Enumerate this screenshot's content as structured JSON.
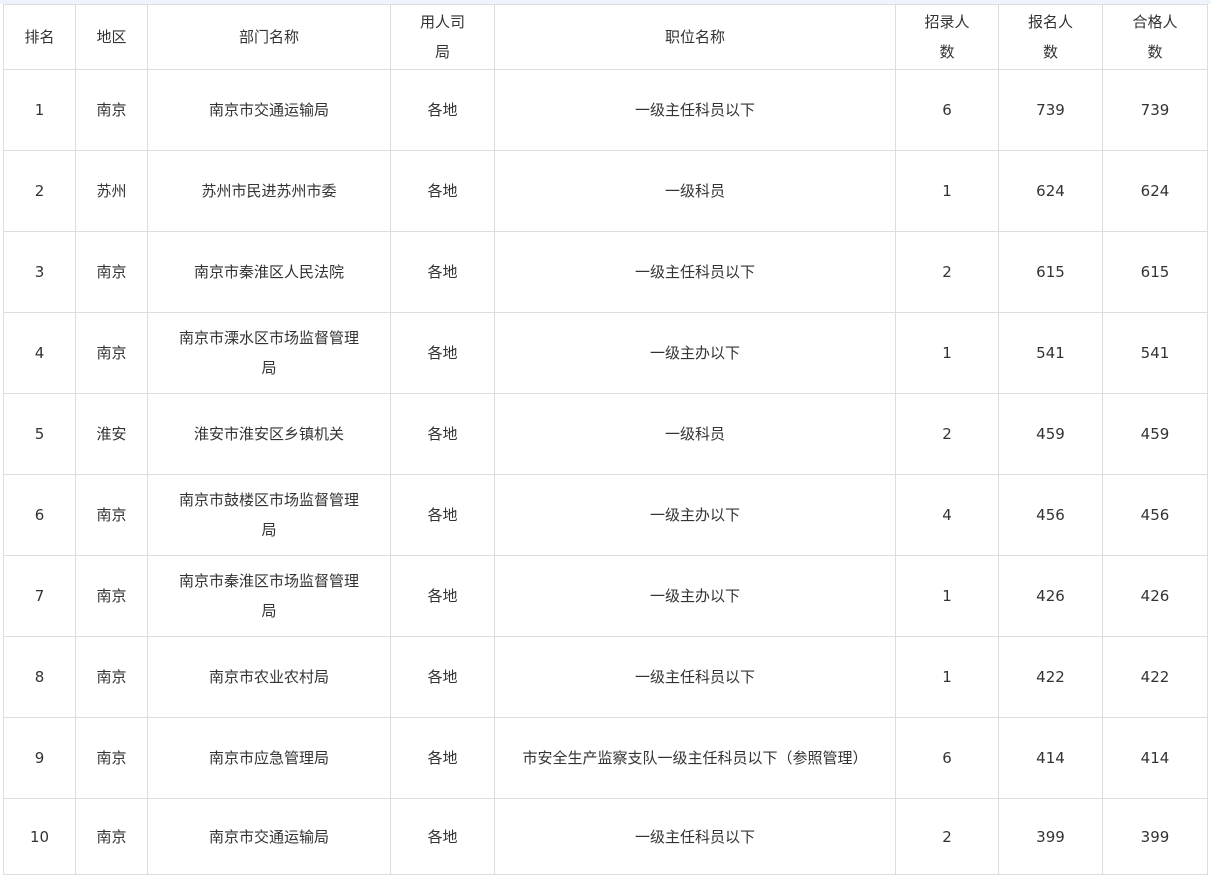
{
  "table": {
    "headers": [
      "排名",
      "地区",
      "部门名称",
      "用人司局",
      "职位名称",
      "招录人数",
      "报名人数",
      "合格人数"
    ],
    "rows": [
      [
        "1",
        "南京",
        "南京市交通运输局",
        "各地",
        "一级主任科员以下",
        "6",
        "739",
        "739"
      ],
      [
        "2",
        "苏州",
        "苏州市民进苏州市委",
        "各地",
        "一级科员",
        "1",
        "624",
        "624"
      ],
      [
        "3",
        "南京",
        "南京市秦淮区人民法院",
        "各地",
        "一级主任科员以下",
        "2",
        "615",
        "615"
      ],
      [
        "4",
        "南京",
        "南京市溧水区市场监督管理局",
        "各地",
        "一级主办以下",
        "1",
        "541",
        "541"
      ],
      [
        "5",
        "淮安",
        "淮安市淮安区乡镇机关",
        "各地",
        "一级科员",
        "2",
        "459",
        "459"
      ],
      [
        "6",
        "南京",
        "南京市鼓楼区市场监督管理局",
        "各地",
        "一级主办以下",
        "4",
        "456",
        "456"
      ],
      [
        "7",
        "南京",
        "南京市秦淮区市场监督管理局",
        "各地",
        "一级主办以下",
        "1",
        "426",
        "426"
      ],
      [
        "8",
        "南京",
        "南京市农业农村局",
        "各地",
        "一级主任科员以下",
        "1",
        "422",
        "422"
      ],
      [
        "9",
        "南京",
        "南京市应急管理局",
        "各地",
        "市安全生产监察支队一级主任科员以下（参照管理）",
        "6",
        "414",
        "414"
      ],
      [
        "10",
        "南京",
        "南京市交通运输局",
        "各地",
        "一级主任科员以下",
        "2",
        "399",
        "399"
      ]
    ]
  }
}
